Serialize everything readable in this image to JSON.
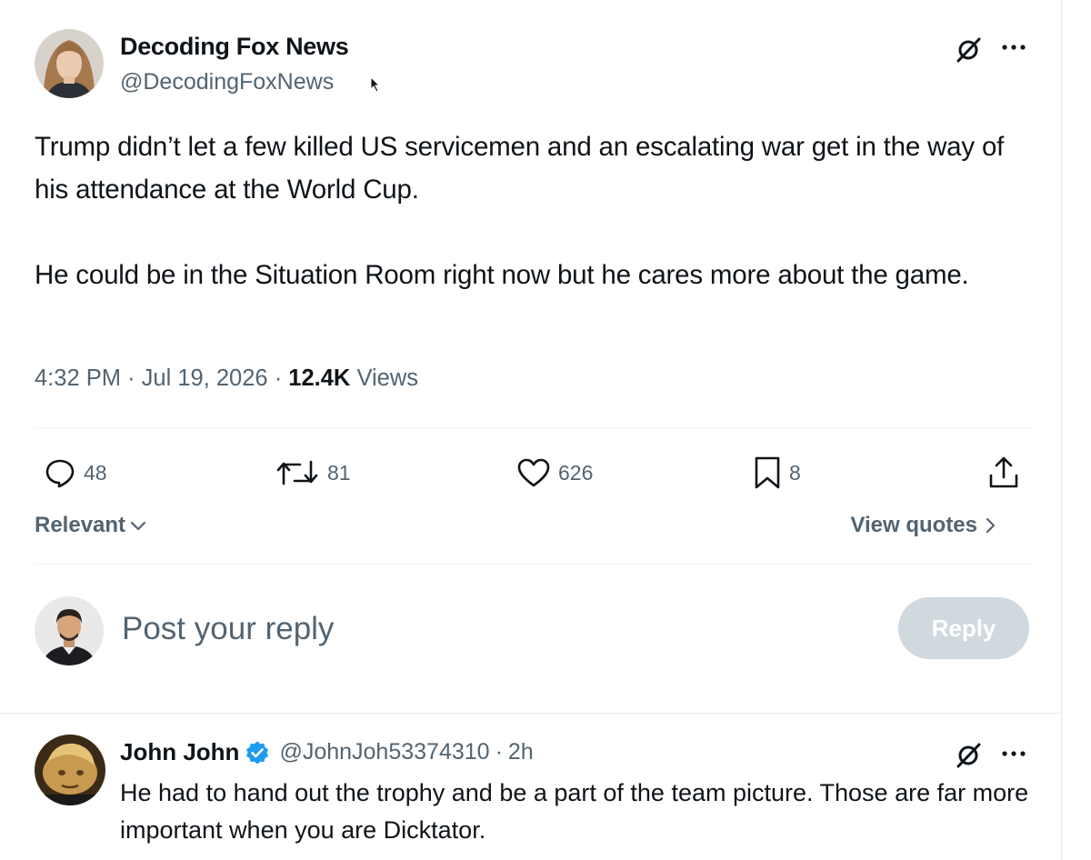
{
  "post": {
    "author": {
      "display_name": "Decoding Fox News",
      "handle": "@DecodingFoxNews"
    },
    "text_paragraphs": [
      "Trump didn’t let a few killed US servicemen and an escalating war get in the way of his attendance at the World Cup.",
      "He could be in the Situation Room right now but he cares more about the game."
    ],
    "time": "4:32 PM",
    "separator": "·",
    "date": "Jul 19, 2026",
    "views_count": "12.4K",
    "views_label": "Views",
    "actions": {
      "replies": "48",
      "reposts": "81",
      "likes": "626",
      "bookmarks": "8"
    },
    "icons": [
      "grok-icon",
      "more-icon",
      "reply-icon",
      "repost-icon",
      "like-icon",
      "bookmark-icon",
      "share-icon"
    ]
  },
  "sort": {
    "label": "Relevant",
    "icon": "chevron-down-icon"
  },
  "view_quotes": {
    "label": "View quotes",
    "icon": "chevron-right-icon"
  },
  "composer": {
    "placeholder": "Post your reply",
    "button_label": "Reply"
  },
  "replies": [
    {
      "display_name": "John John",
      "verified": true,
      "handle": "@JohnJoh53374310",
      "separator": "·",
      "age": "2h",
      "text": "He had to hand out the trophy and be a part of the team picture.  Those are far more important when you are Dicktator."
    }
  ],
  "colors": {
    "text_primary": "#0f1419",
    "text_secondary": "#536471",
    "divider": "#eff3f4",
    "reply_button_disabled": "#cfd9de",
    "verified_badge": "#1d9bf0"
  }
}
